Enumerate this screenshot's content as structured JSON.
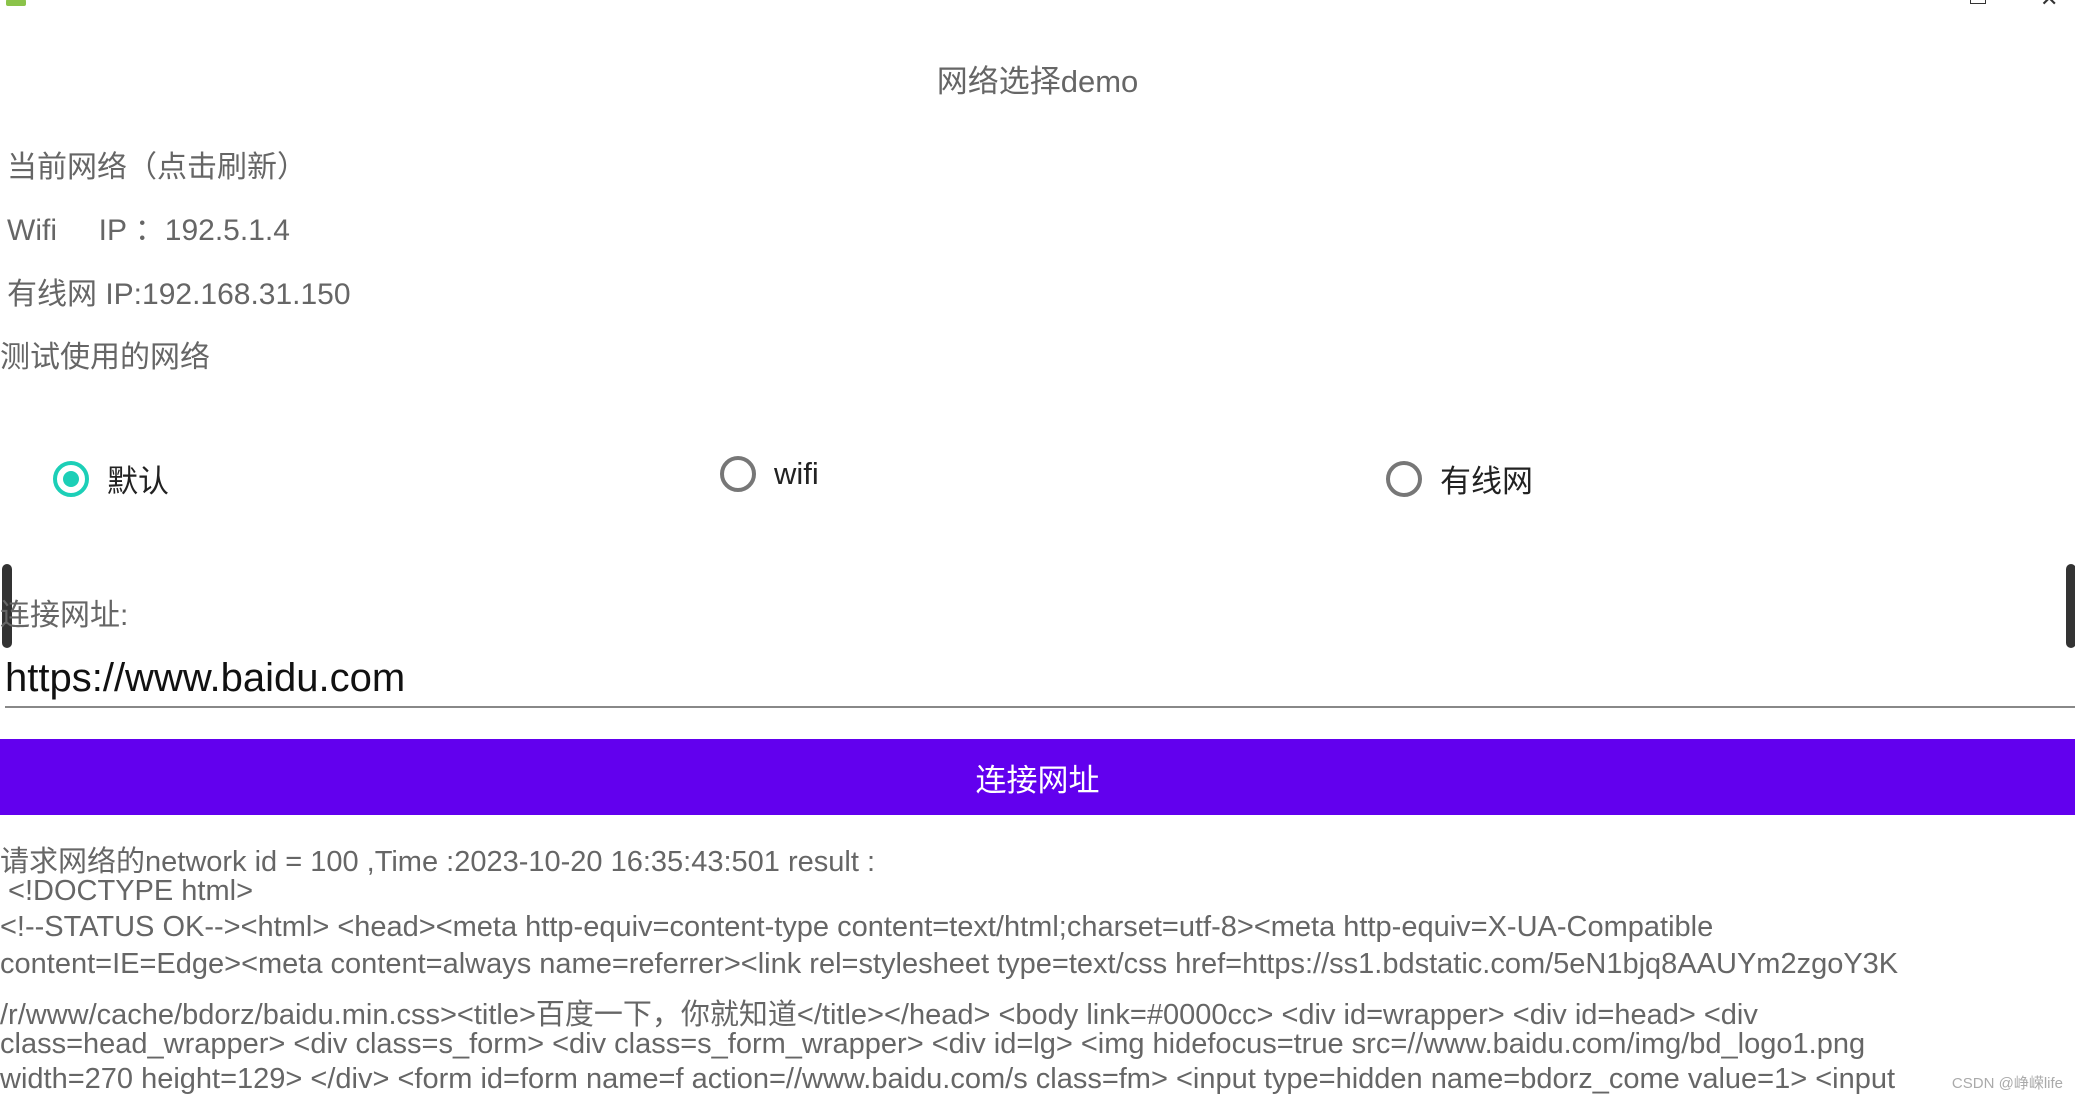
{
  "window": {
    "app_icon": "android-icon"
  },
  "header": {
    "title": "网络选择demo"
  },
  "info": {
    "current_network_label": "当前网络（点击刷新）",
    "wifi_ip": "Wifi     IP ：192.5.1.4",
    "wired_ip": "有线网 IP:192.168.31.150",
    "test_network_label": "测试使用的网络"
  },
  "network_options": [
    {
      "label": "默认",
      "selected": true
    },
    {
      "label": "wifi",
      "selected": false
    },
    {
      "label": "有线网",
      "selected": false
    }
  ],
  "url": {
    "label": "连接网址:",
    "value": "https://www.baidu.com"
  },
  "connect_button": "连接网址",
  "output": {
    "lines": [
      "请求网络的network id = 100  ,Time :2023-10-20 16:35:43:501 result :",
      " <!DOCTYPE html>",
      "<!--STATUS OK--><html> <head><meta http-equiv=content-type content=text/html;charset=utf-8><meta http-equiv=X-UA-Compatible",
      "content=IE=Edge><meta content=always name=referrer><link rel=stylesheet type=text/css href=https://ss1.bdstatic.com/5eN1bjq8AAUYm2zgoY3K",
      "/r/www/cache/bdorz/baidu.min.css><title>百度一下，你就知道</title></head> <body link=#0000cc> <div id=wrapper> <div id=head> <div",
      "class=head_wrapper> <div class=s_form> <div class=s_form_wrapper> <div id=lg> <img hidefocus=true src=//www.baidu.com/img/bd_logo1.png",
      "width=270 height=129> </div> <form id=form name=f action=//www.baidu.com/s class=fm> <input type=hidden name=bdorz_come value=1> <input"
    ]
  },
  "watermark": "CSDN @峥嵘life",
  "colors": {
    "accent": "#6200ee",
    "radio_checked": "#1ccfb7"
  }
}
